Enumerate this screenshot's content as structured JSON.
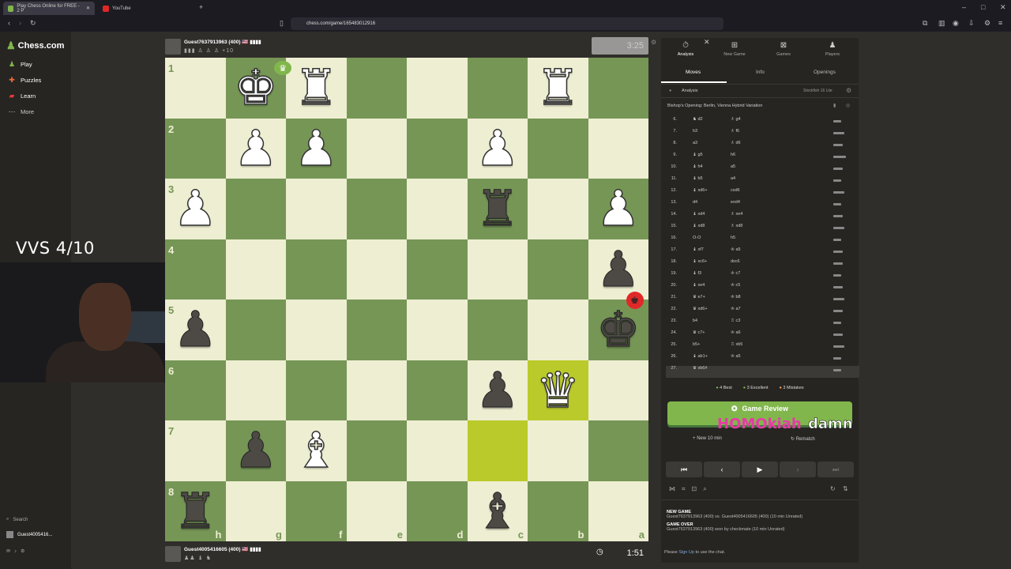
{
  "browser": {
    "tabs": [
      "Play Chess Online for FREE - 2 P",
      "YouTube"
    ],
    "url": "chess.com/game/165483012916"
  },
  "sidebar": {
    "logo": "Chess.com",
    "items": [
      {
        "label": "Play",
        "icon": "play-icon"
      },
      {
        "label": "Puzzles",
        "icon": "puzzle-icon"
      },
      {
        "label": "Learn",
        "icon": "learn-icon"
      },
      {
        "label": "More",
        "icon": "more-icon"
      }
    ],
    "search": "Search",
    "user": "Guest4005416..."
  },
  "overlay": {
    "vvs": "VVS 4/10",
    "text_a": "HOMOkiah",
    "text_b": "damn"
  },
  "top_player": {
    "name": "Guest7637913963 (400) 🇺🇸 ▮▮▮▮",
    "captured": "▮▮▮ ♙ ♙ ♙ +10",
    "clock": "3:25"
  },
  "bottom_player": {
    "name": "Guest4005416605 (400) 🇺🇸 ▮▮▮▮",
    "captured": "♟♟ ♝ ♞",
    "clock": "1:51"
  },
  "board": {
    "ranks": [
      "1",
      "2",
      "3",
      "4",
      "5",
      "6",
      "7",
      "8"
    ],
    "files": [
      "h",
      "g",
      "f",
      "e",
      "d",
      "c",
      "b",
      "a"
    ],
    "pieces": [
      {
        "glyph": "♚",
        "color": "w",
        "r": 0,
        "c": 1
      },
      {
        "glyph": "♜",
        "color": "w",
        "r": 0,
        "c": 2
      },
      {
        "glyph": "♜",
        "color": "w",
        "r": 0,
        "c": 6
      },
      {
        "glyph": "♟",
        "color": "w",
        "r": 1,
        "c": 1
      },
      {
        "glyph": "♟",
        "color": "w",
        "r": 1,
        "c": 2
      },
      {
        "glyph": "♟",
        "color": "w",
        "r": 1,
        "c": 5
      },
      {
        "glyph": "♟",
        "color": "w",
        "r": 2,
        "c": 0
      },
      {
        "glyph": "♜",
        "color": "b",
        "r": 2,
        "c": 5
      },
      {
        "glyph": "♟",
        "color": "w",
        "r": 2,
        "c": 7
      },
      {
        "glyph": "♟",
        "color": "b",
        "r": 3,
        "c": 7
      },
      {
        "glyph": "♟",
        "color": "b",
        "r": 4,
        "c": 0
      },
      {
        "glyph": "♚",
        "color": "b",
        "r": 4,
        "c": 7
      },
      {
        "glyph": "♟",
        "color": "b",
        "r": 5,
        "c": 5
      },
      {
        "glyph": "♛",
        "color": "w",
        "r": 5,
        "c": 6
      },
      {
        "glyph": "♟",
        "color": "b",
        "r": 6,
        "c": 1
      },
      {
        "glyph": "♝",
        "color": "w",
        "r": 6,
        "c": 2
      },
      {
        "glyph": "♜",
        "color": "b",
        "r": 7,
        "c": 0
      },
      {
        "glyph": "♝",
        "color": "b",
        "r": 7,
        "c": 5
      }
    ],
    "highlights": [
      {
        "r": 5,
        "c": 6
      },
      {
        "r": 6,
        "c": 5
      }
    ]
  },
  "panel": {
    "tabs": [
      {
        "label": "Analysis",
        "icon": "analysis-icon"
      },
      {
        "label": "New Game",
        "icon": "new-game-icon"
      },
      {
        "label": "Games",
        "icon": "games-icon"
      },
      {
        "label": "Players",
        "icon": "players-icon"
      }
    ],
    "subtabs": [
      "Moves",
      "Info",
      "Openings"
    ],
    "analysis_label": "Analysis",
    "engine": "Stockfish 16 Lite",
    "opening": "Bishop's Opening: Berlin, Vienna Hybrid Variation",
    "moves": [
      {
        "n": "6.",
        "w": "♞ d2",
        "b": "♗ g4"
      },
      {
        "n": "7.",
        "w": "h3",
        "b": "♗ f6"
      },
      {
        "n": "8.",
        "w": "a3",
        "b": "♗ d6"
      },
      {
        "n": "9.",
        "w": "♝ g5",
        "b": "h6"
      },
      {
        "n": "10.",
        "w": "♝ h4",
        "b": "a5"
      },
      {
        "n": "11.",
        "w": "♝ b5",
        "b": "a4"
      },
      {
        "n": "12.",
        "w": "♝ xd6+",
        "b": "cxd6"
      },
      {
        "n": "13.",
        "w": "d4",
        "b": "exd4"
      },
      {
        "n": "14.",
        "w": "♝ xd4",
        "b": "♗ xe4"
      },
      {
        "n": "15.",
        "w": "♝ xd8",
        "b": "♗ xd8"
      },
      {
        "n": "16.",
        "w": "O-O",
        "b": "h5"
      },
      {
        "n": "17.",
        "w": "♝ xf7",
        "b": "♔ a5"
      },
      {
        "n": "18.",
        "w": "♝ xc6+",
        "b": "dxc6"
      },
      {
        "n": "19.",
        "w": "♝ f3",
        "b": "♔ c7"
      },
      {
        "n": "20.",
        "w": "♝ xe4",
        "b": "♔ c5"
      },
      {
        "n": "21.",
        "w": "♛ e7+",
        "b": "♔ b8"
      },
      {
        "n": "22.",
        "w": "♛ xd6+",
        "b": "♔ a7"
      },
      {
        "n": "23.",
        "w": "b4",
        "b": "♖ c3"
      },
      {
        "n": "24.",
        "w": "♛ c7+",
        "b": "♔ a6"
      },
      {
        "n": "25.",
        "w": "b5+",
        "b": "♖ xb5"
      },
      {
        "n": "26.",
        "w": "♝ ab1+",
        "b": "♔ a5"
      },
      {
        "n": "27.",
        "w": "♛ xb6#",
        "b": ""
      }
    ],
    "stats": [
      {
        "label": "4 Best",
        "color": "#81b64c"
      },
      {
        "label": "3 Excellent",
        "color": "#81b64c"
      },
      {
        "label": "3 Mistakes",
        "color": "#ffa459"
      }
    ],
    "review_label": "Game Review",
    "new_label": "New 10 min",
    "rematch_label": "Rematch",
    "log": [
      {
        "title": "NEW GAME",
        "text": "Guest7637913963 (400) vs. Guest4005416605 (400) (10 min Unrated)"
      },
      {
        "title": "GAME OVER",
        "text": "Guest7637913963 (400) won by checkmate (10 min Unrated)"
      }
    ],
    "chat_prefix": "Please",
    "chat_link": "Sign Up",
    "chat_suffix": "to use the chat."
  }
}
